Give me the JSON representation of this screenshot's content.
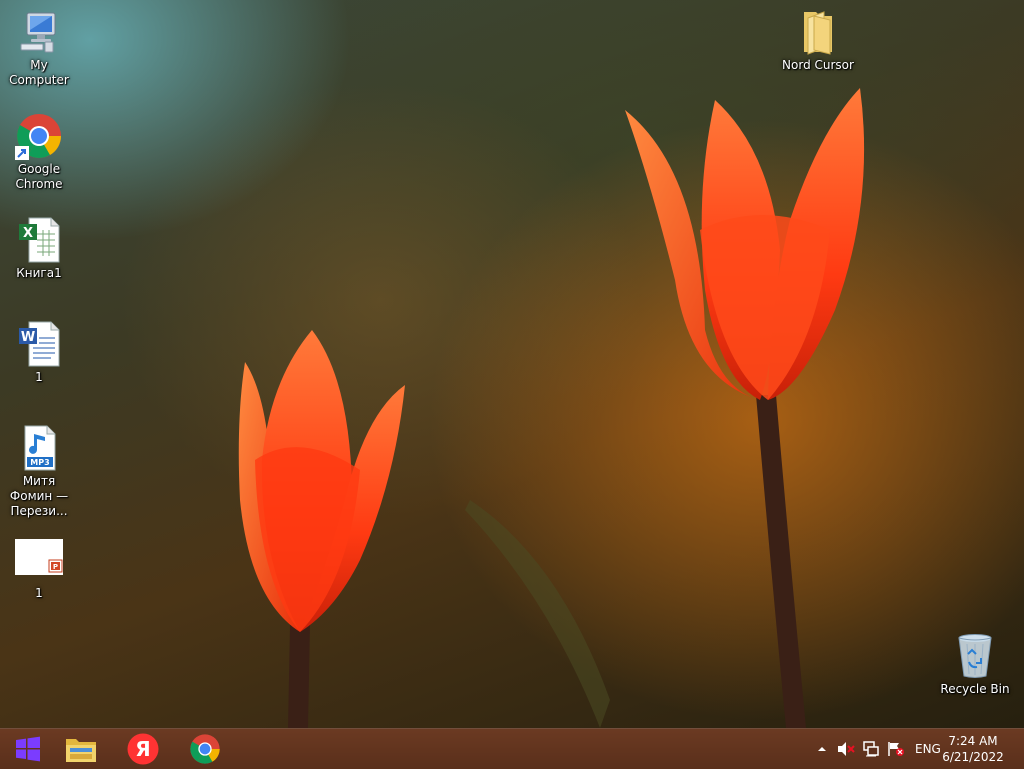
{
  "desktop": {
    "icons": [
      {
        "label": "My Computer",
        "icon": "computer-icon"
      },
      {
        "label": "Google Chrome",
        "icon": "chrome-icon"
      },
      {
        "label": "Книга1",
        "icon": "excel-file-icon"
      },
      {
        "label": "1",
        "icon": "word-file-icon"
      },
      {
        "label": "Митя Фомин — Перези...",
        "icon": "mp3-file-icon"
      },
      {
        "label": "1",
        "icon": "powerpoint-file-icon"
      },
      {
        "label": "Nord Cursor",
        "icon": "folder-icon"
      },
      {
        "label": "Recycle Bin",
        "icon": "recycle-bin-icon"
      }
    ]
  },
  "taskbar": {
    "start": {
      "icon": "windows-logo-icon"
    },
    "pinned": [
      {
        "icon": "file-explorer-icon"
      },
      {
        "icon": "yandex-browser-icon",
        "glyph": "Я"
      },
      {
        "icon": "chrome-icon"
      }
    ],
    "tray": {
      "icons": [
        "show-hidden-icons-chevron-icon",
        "volume-muted-icon",
        "network-icon",
        "action-center-flag-icon"
      ],
      "language": "ENG",
      "time": "7:24 AM",
      "date": "6/21/2022"
    }
  },
  "colors": {
    "taskbar": "#5e311d",
    "tulip": "#ff4a1a",
    "start_logo": "#7b3cff"
  }
}
